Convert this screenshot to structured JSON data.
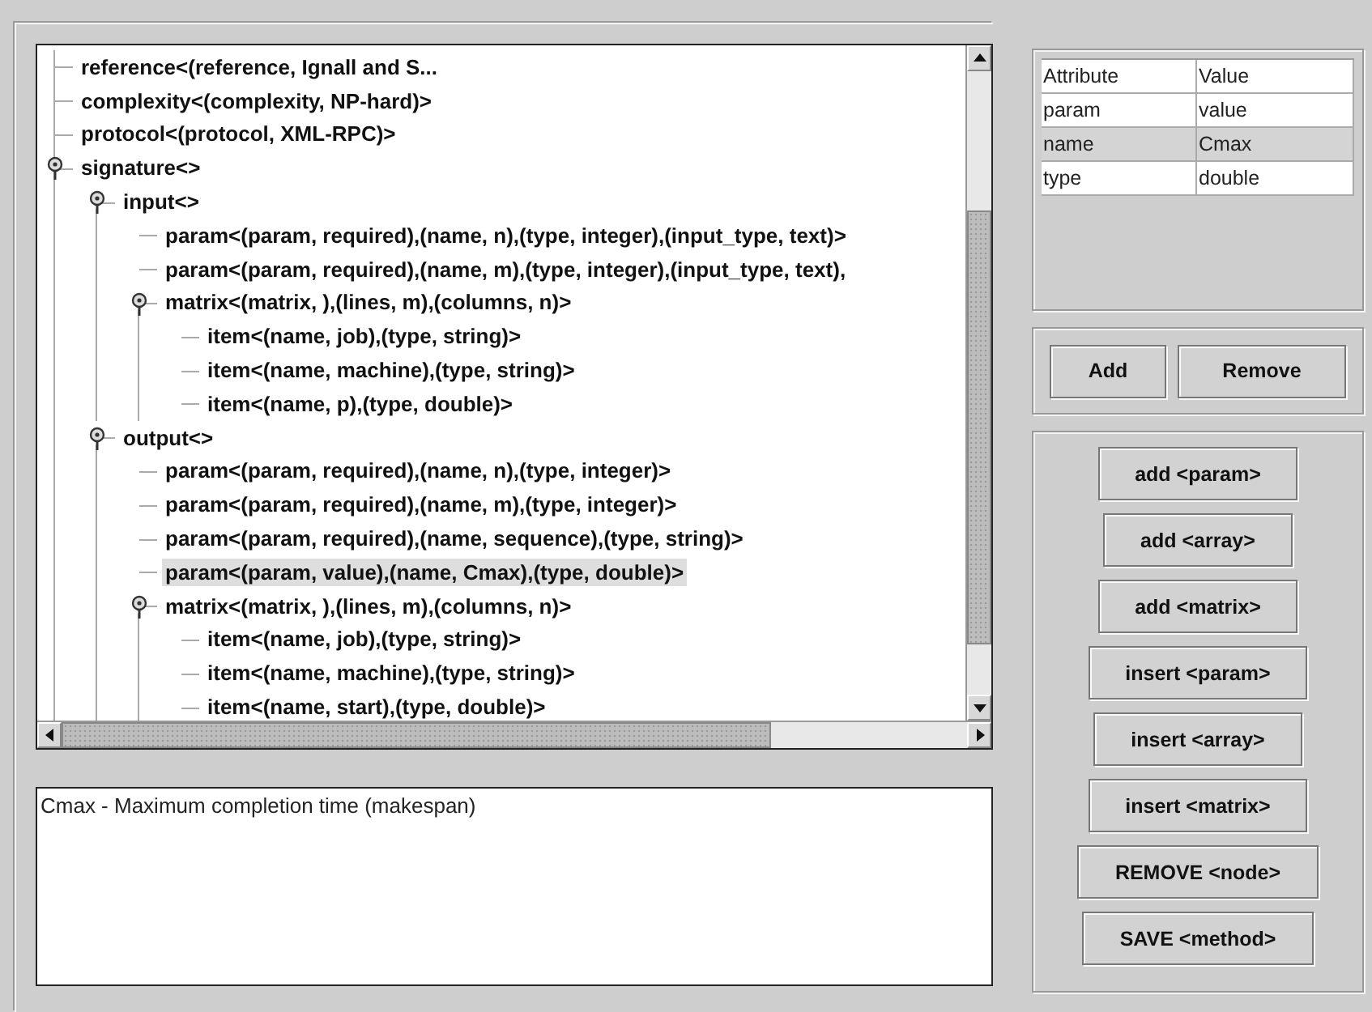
{
  "tree": {
    "nodes": [
      {
        "label": "reference<(reference, Ignall and S...",
        "selected": false
      },
      {
        "label": "complexity<(complexity, NP-hard)>",
        "selected": false
      },
      {
        "label": "protocol<(protocol, XML-RPC)>",
        "selected": false
      },
      {
        "label": "signature<>",
        "selected": false,
        "expanded": true,
        "children": [
          {
            "label": "input<>",
            "selected": false,
            "expanded": true,
            "children": [
              {
                "label": "param<(param, required),(name, n),(type, integer),(input_type, text)>",
                "selected": false
              },
              {
                "label": "param<(param, required),(name, m),(type, integer),(input_type, text),",
                "selected": false
              },
              {
                "label": "matrix<(matrix, ),(lines, m),(columns, n)>",
                "selected": false,
                "expanded": true,
                "children": [
                  {
                    "label": "item<(name, job),(type, string)>",
                    "selected": false
                  },
                  {
                    "label": "item<(name, machine),(type, string)>",
                    "selected": false
                  },
                  {
                    "label": "item<(name, p),(type, double)>",
                    "selected": false
                  }
                ]
              }
            ]
          },
          {
            "label": "output<>",
            "selected": false,
            "expanded": true,
            "children": [
              {
                "label": "param<(param, required),(name, n),(type, integer)>",
                "selected": false
              },
              {
                "label": "param<(param, required),(name, m),(type, integer)>",
                "selected": false
              },
              {
                "label": "param<(param, required),(name, sequence),(type, string)>",
                "selected": false
              },
              {
                "label": "param<(param, value),(name, Cmax),(type, double)>",
                "selected": true
              },
              {
                "label": "matrix<(matrix, ),(lines, m),(columns, n)>",
                "selected": false,
                "expanded": true,
                "children": [
                  {
                    "label": "item<(name, job),(type, string)>",
                    "selected": false
                  },
                  {
                    "label": "item<(name, machine),(type, string)>",
                    "selected": false
                  },
                  {
                    "label": "item<(name, start),(type, double)>",
                    "selected": false
                  }
                ]
              }
            ]
          }
        ]
      }
    ]
  },
  "description": "Cmax - Maximum completion time (makespan)",
  "attributes": {
    "columns": [
      "Attribute",
      "Value"
    ],
    "rows": [
      {
        "cells": [
          "param",
          "value"
        ],
        "selected": false
      },
      {
        "cells": [
          "name",
          "Cmax"
        ],
        "selected": true
      },
      {
        "cells": [
          "type",
          "double"
        ],
        "selected": false
      }
    ]
  },
  "attribute_buttons": [
    "Add",
    "Remove"
  ],
  "actions": [
    "add <param>",
    "add <array>",
    "add <matrix>",
    "insert <param>",
    "insert <array>",
    "insert <matrix>",
    "REMOVE <node>",
    "SAVE <method>"
  ]
}
